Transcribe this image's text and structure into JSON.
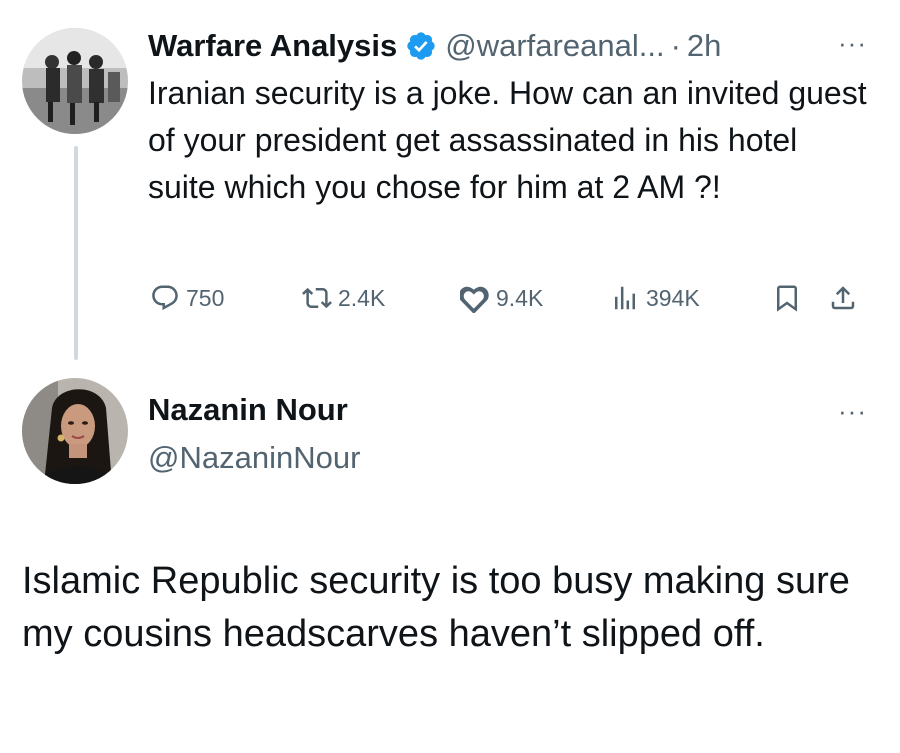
{
  "parent_tweet": {
    "author_name": "Warfare Analysis",
    "handle": "@warfareanal...",
    "dot": "·",
    "time": "2h",
    "more": "···",
    "text": "Iranian security is a joke. How can an invited guest of your president get assassinated in his hotel suite which you chose for him at 2 AM ?!",
    "stats": {
      "replies": "750",
      "retweets": "2.4K",
      "likes": "9.4K",
      "views": "394K"
    },
    "verified_color": "#1d9bf0"
  },
  "reply_tweet": {
    "author_name": "Nazanin Nour",
    "handle": "@NazaninNour",
    "more": "···",
    "text": "Islamic Republic security is too busy making sure my cousins headscarves haven’t slipped off."
  },
  "icons": [
    "verified-badge-icon",
    "reply-icon",
    "retweet-icon",
    "like-icon",
    "views-icon",
    "bookmark-icon",
    "share-icon",
    "more-icon"
  ]
}
